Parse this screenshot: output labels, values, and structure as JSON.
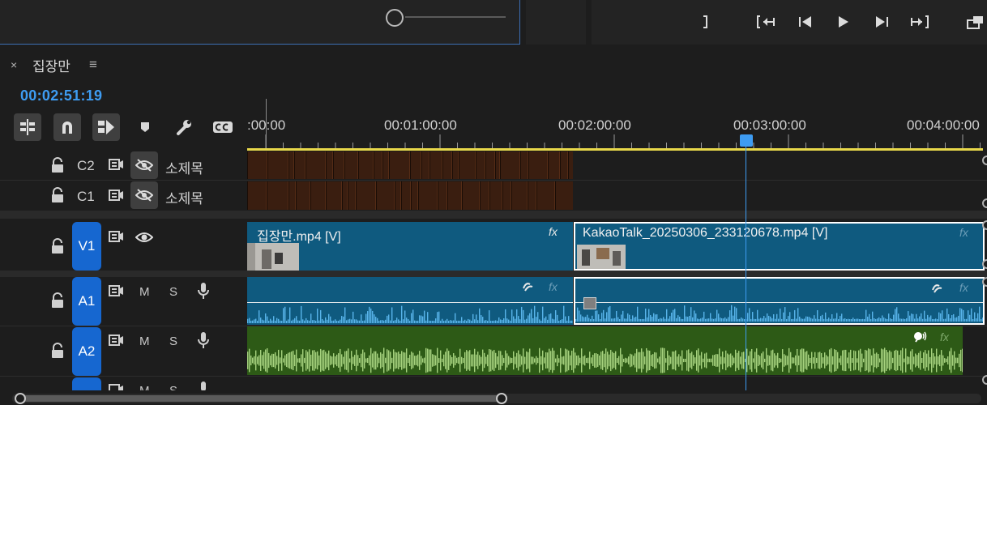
{
  "panel": {
    "close_glyph": "×",
    "title": "집장만",
    "menu_glyph": "≡",
    "timecode": "00:02:51:19"
  },
  "ruler": {
    "labels": [
      ":00:00",
      "00:01:00:00",
      "00:02:00:00",
      "00:03:00:00",
      "00:04:00:00"
    ]
  },
  "tracks": {
    "C2": {
      "name": "C2",
      "label": "소제목"
    },
    "C1": {
      "name": "C1",
      "label": "소제목"
    },
    "V1": {
      "name": "V1"
    },
    "A1": {
      "name": "A1",
      "mute": "M",
      "solo": "S"
    },
    "A2": {
      "name": "A2",
      "mute": "M",
      "solo": "S"
    },
    "A3": {
      "mute": "M",
      "solo": "S"
    }
  },
  "clips": {
    "v1_clip1": {
      "label": "집장만.mp4 [V]",
      "fx": "fx"
    },
    "v1_clip2": {
      "label": "KakaoTalk_20250306_233120678.mp4 [V]",
      "fx": "fx"
    },
    "a1_clip1": {
      "fx": "fx"
    },
    "a1_clip2": {
      "fx": "fx"
    },
    "a2_clip1": {
      "fx": "fx"
    }
  },
  "colors": {
    "accent": "#3e9cf2",
    "track_badge": "#1667d0",
    "video_clip": "#0f5a7f",
    "audio_green": "#2d5a16",
    "caption_clip": "#3a1e10",
    "ruler_bar": "#e8d84a"
  },
  "icons": {
    "tools": [
      "insert-overwrite-icon",
      "snap-magnet-icon",
      "linked-selection-icon",
      "marker-icon",
      "wrench-icon",
      "captions-icon"
    ],
    "transport": [
      "mark-out-icon",
      "go-to-in-icon",
      "step-back-icon",
      "play-icon",
      "step-forward-icon",
      "go-to-out-icon",
      "export-frame-icon"
    ]
  }
}
